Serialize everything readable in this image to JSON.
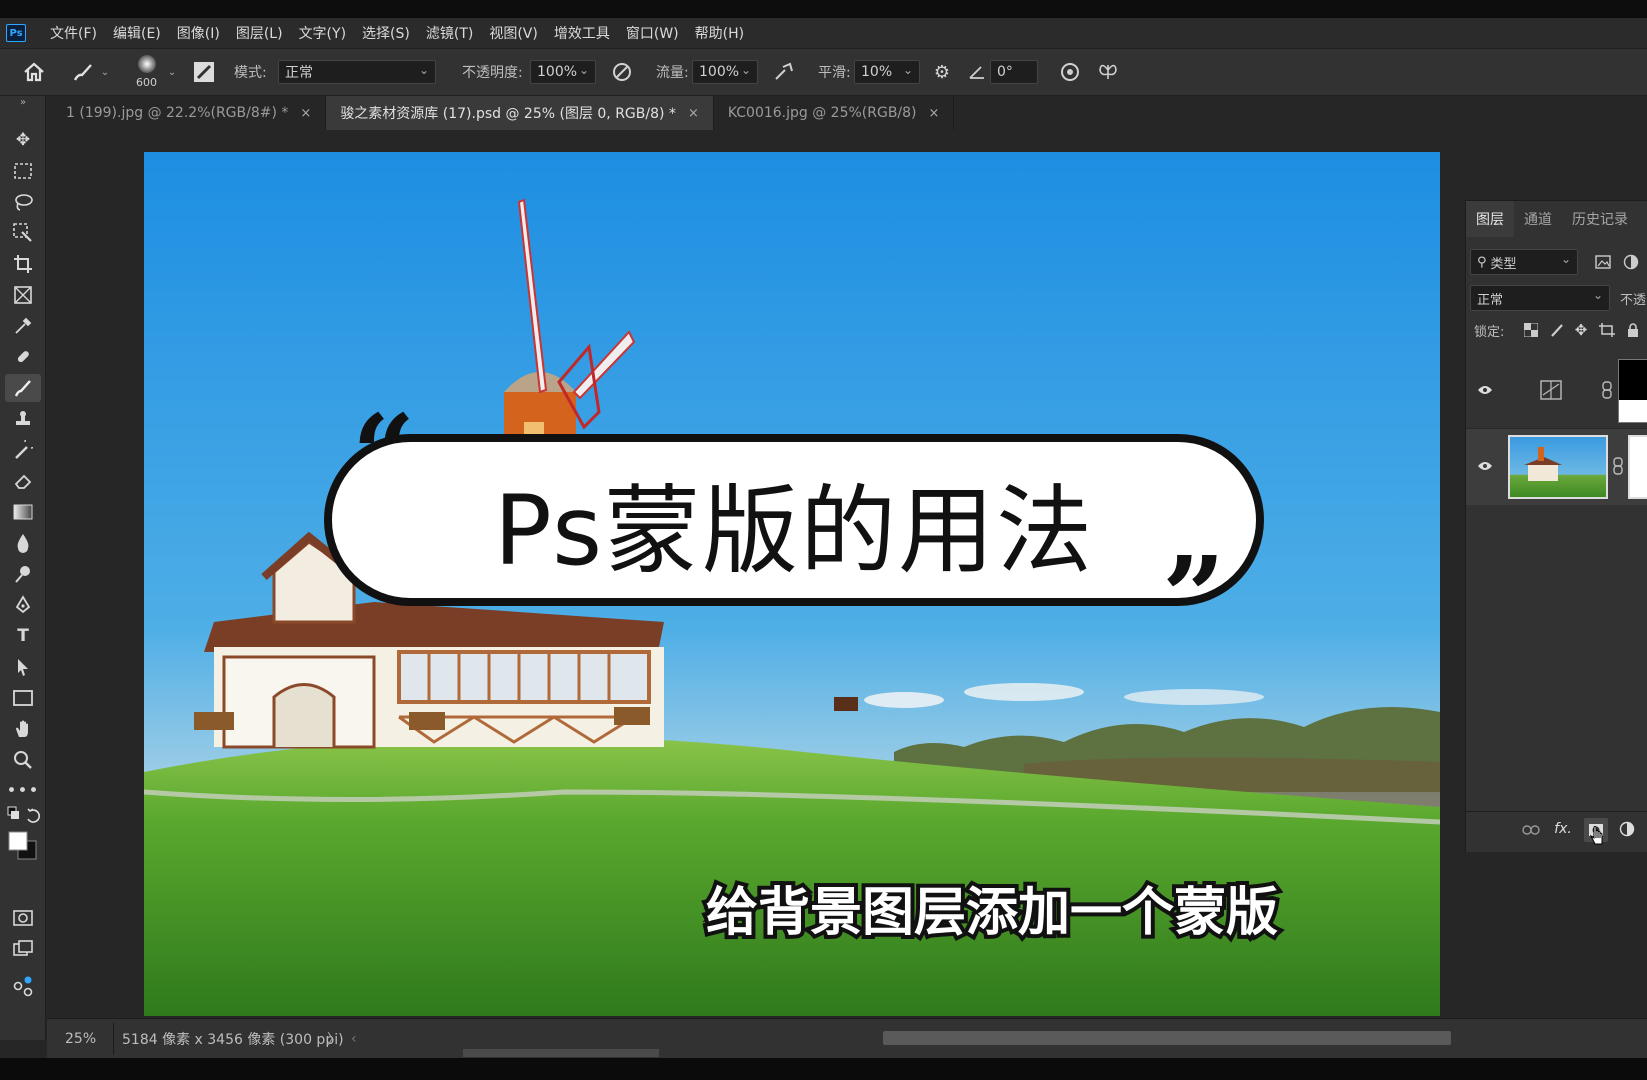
{
  "app": {
    "logo": "Ps"
  },
  "menu": [
    "文件(F)",
    "编辑(E)",
    "图像(I)",
    "图层(L)",
    "文字(Y)",
    "选择(S)",
    "滤镜(T)",
    "视图(V)",
    "增效工具",
    "窗口(W)",
    "帮助(H)"
  ],
  "options": {
    "brush_size": "600",
    "mode_label": "模式:",
    "mode_value": "正常",
    "opacity_label": "不透明度:",
    "opacity_value": "100%",
    "flow_label": "流量:",
    "flow_value": "100%",
    "smooth_label": "平滑:",
    "smooth_value": "10%",
    "angle_value": "0°"
  },
  "tabs": [
    {
      "label": "1 (199).jpg @ 22.2%(RGB/8#) *",
      "close": "×"
    },
    {
      "label": "骏之素材资源库 (17).psd @ 25% (图层 0, RGB/8) *",
      "close": "×"
    },
    {
      "label": "KC0016.jpg @ 25%(RGB/8)",
      "close": "×"
    }
  ],
  "canvas": {
    "title": "Ps蒙版的用法",
    "quote_open": "“",
    "quote_close": "”",
    "subtitle": "给背景图层添加一个蒙版"
  },
  "layers_panel": {
    "tabs": [
      "图层",
      "通道",
      "历史记录"
    ],
    "filter_label": "类型",
    "blend_mode": "正常",
    "opacity_cut": "不透",
    "lock_label": "锁定:",
    "fx_label": "fx."
  },
  "status": {
    "zoom": "25%",
    "doc_info": "5184 像素 x 3456 像素 (300 ppi)",
    "arrow": "〉",
    "back": "‹"
  },
  "colors": {
    "accent": "#31a8ff",
    "panel": "#323232",
    "workspace": "#262626"
  }
}
